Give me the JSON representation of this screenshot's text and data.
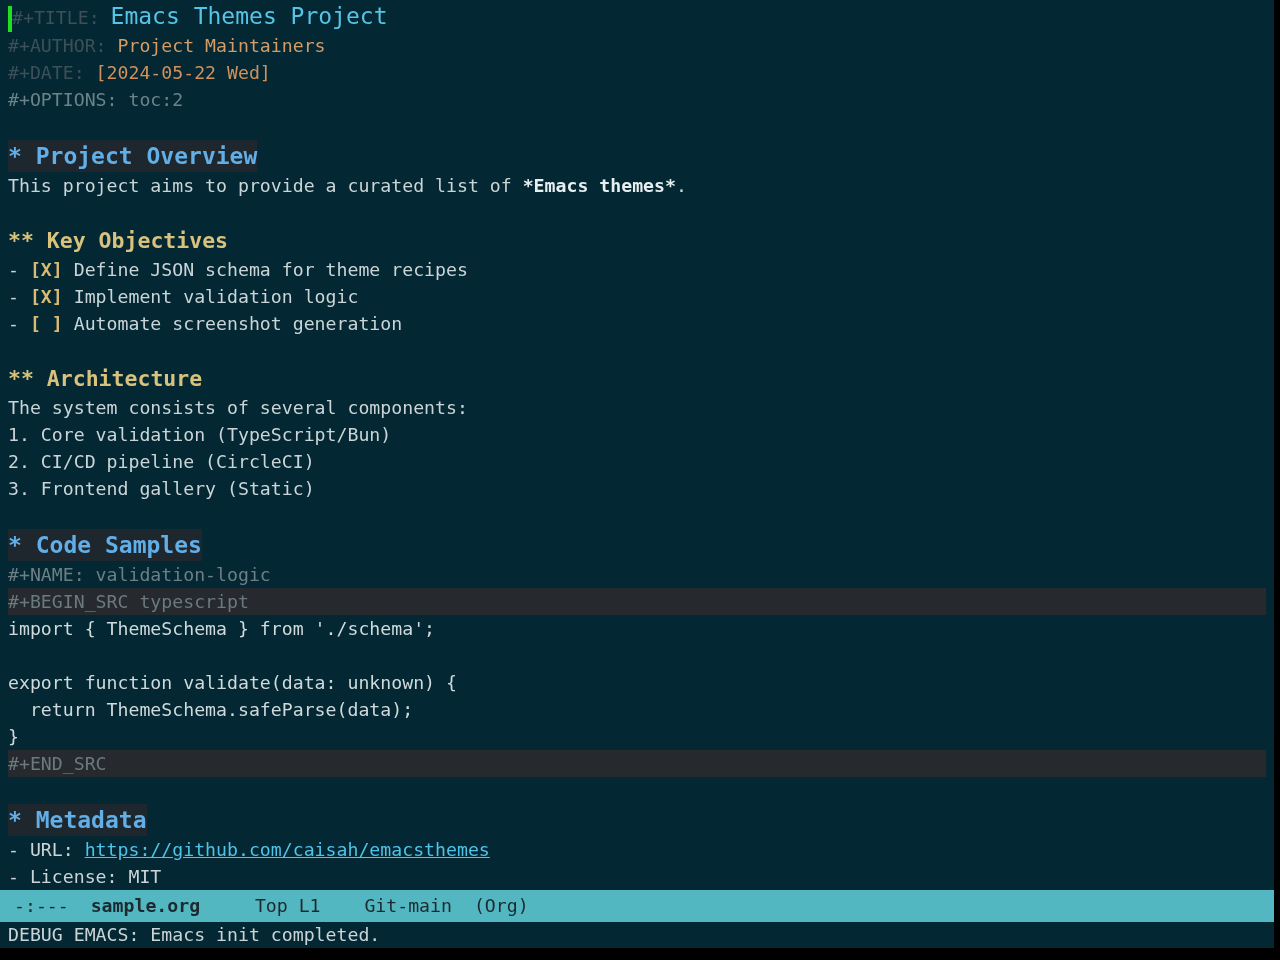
{
  "keywords": [
    {
      "kind": "title",
      "key": "#+TITLE:",
      "value": "Emacs Themes Project"
    },
    {
      "kind": "author",
      "key": "#+AUTHOR:",
      "value": "Project Maintainers"
    },
    {
      "kind": "date",
      "key": "#+DATE:",
      "value": "[2024-05-22 Wed]"
    },
    {
      "kind": "options",
      "key": "#+OPTIONS:",
      "value": "toc:2"
    }
  ],
  "sections": [
    {
      "marker": "*",
      "title": "Project Overview",
      "body": [
        {
          "kind": "paragraph",
          "segments": [
            {
              "text": "This project aims to provide a curated list of ",
              "bold": false
            },
            {
              "text": "*Emacs themes*",
              "bold": true
            },
            {
              "text": ".",
              "bold": false
            }
          ]
        }
      ],
      "children": [
        {
          "marker": "**",
          "title": "Key Objectives",
          "body": [
            {
              "kind": "checklist",
              "items": [
                {
                  "bullet": "-",
                  "box": "[X]",
                  "text": "Define JSON schema for theme recipes"
                },
                {
                  "bullet": "-",
                  "box": "[X]",
                  "text": "Implement validation logic"
                },
                {
                  "bullet": "-",
                  "box": "[ ]",
                  "text": "Automate screenshot generation"
                }
              ]
            }
          ]
        },
        {
          "marker": "**",
          "title": "Architecture",
          "body": [
            {
              "kind": "paragraph",
              "segments": [
                {
                  "text": "The system consists of several components:",
                  "bold": false
                }
              ]
            },
            {
              "kind": "ordered_list",
              "items": [
                "1. Core validation (TypeScript/Bun)",
                "2. CI/CD pipeline (CircleCI)",
                "3. Frontend gallery (Static)"
              ]
            }
          ]
        }
      ]
    },
    {
      "marker": "*",
      "title": "Code Samples",
      "body": [
        {
          "kind": "keyword",
          "key": "#+NAME:",
          "value": "validation-logic"
        },
        {
          "kind": "src_block",
          "begin": "#+BEGIN_SRC typescript",
          "code": "import { ThemeSchema } from './schema';\n\nexport function validate(data: unknown) {\n  return ThemeSchema.safeParse(data);\n}",
          "end": "#+END_SRC"
        }
      ]
    },
    {
      "marker": "*",
      "title": "Metadata",
      "body": [
        {
          "kind": "items",
          "items": [
            {
              "kind": "link",
              "text": "- URL:",
              "link": "https://github.com/caisah/emacsthemes"
            },
            {
              "kind": "plain",
              "text": "- License: MIT"
            }
          ]
        }
      ]
    }
  ],
  "mode_line": {
    "status": "-:---",
    "buffer_name": "sample.org",
    "position": "Top L1",
    "vc_branch": "Git-main",
    "major_mode": "(Org)"
  },
  "echo_area": "DEBUG EMACS: Emacs init completed."
}
